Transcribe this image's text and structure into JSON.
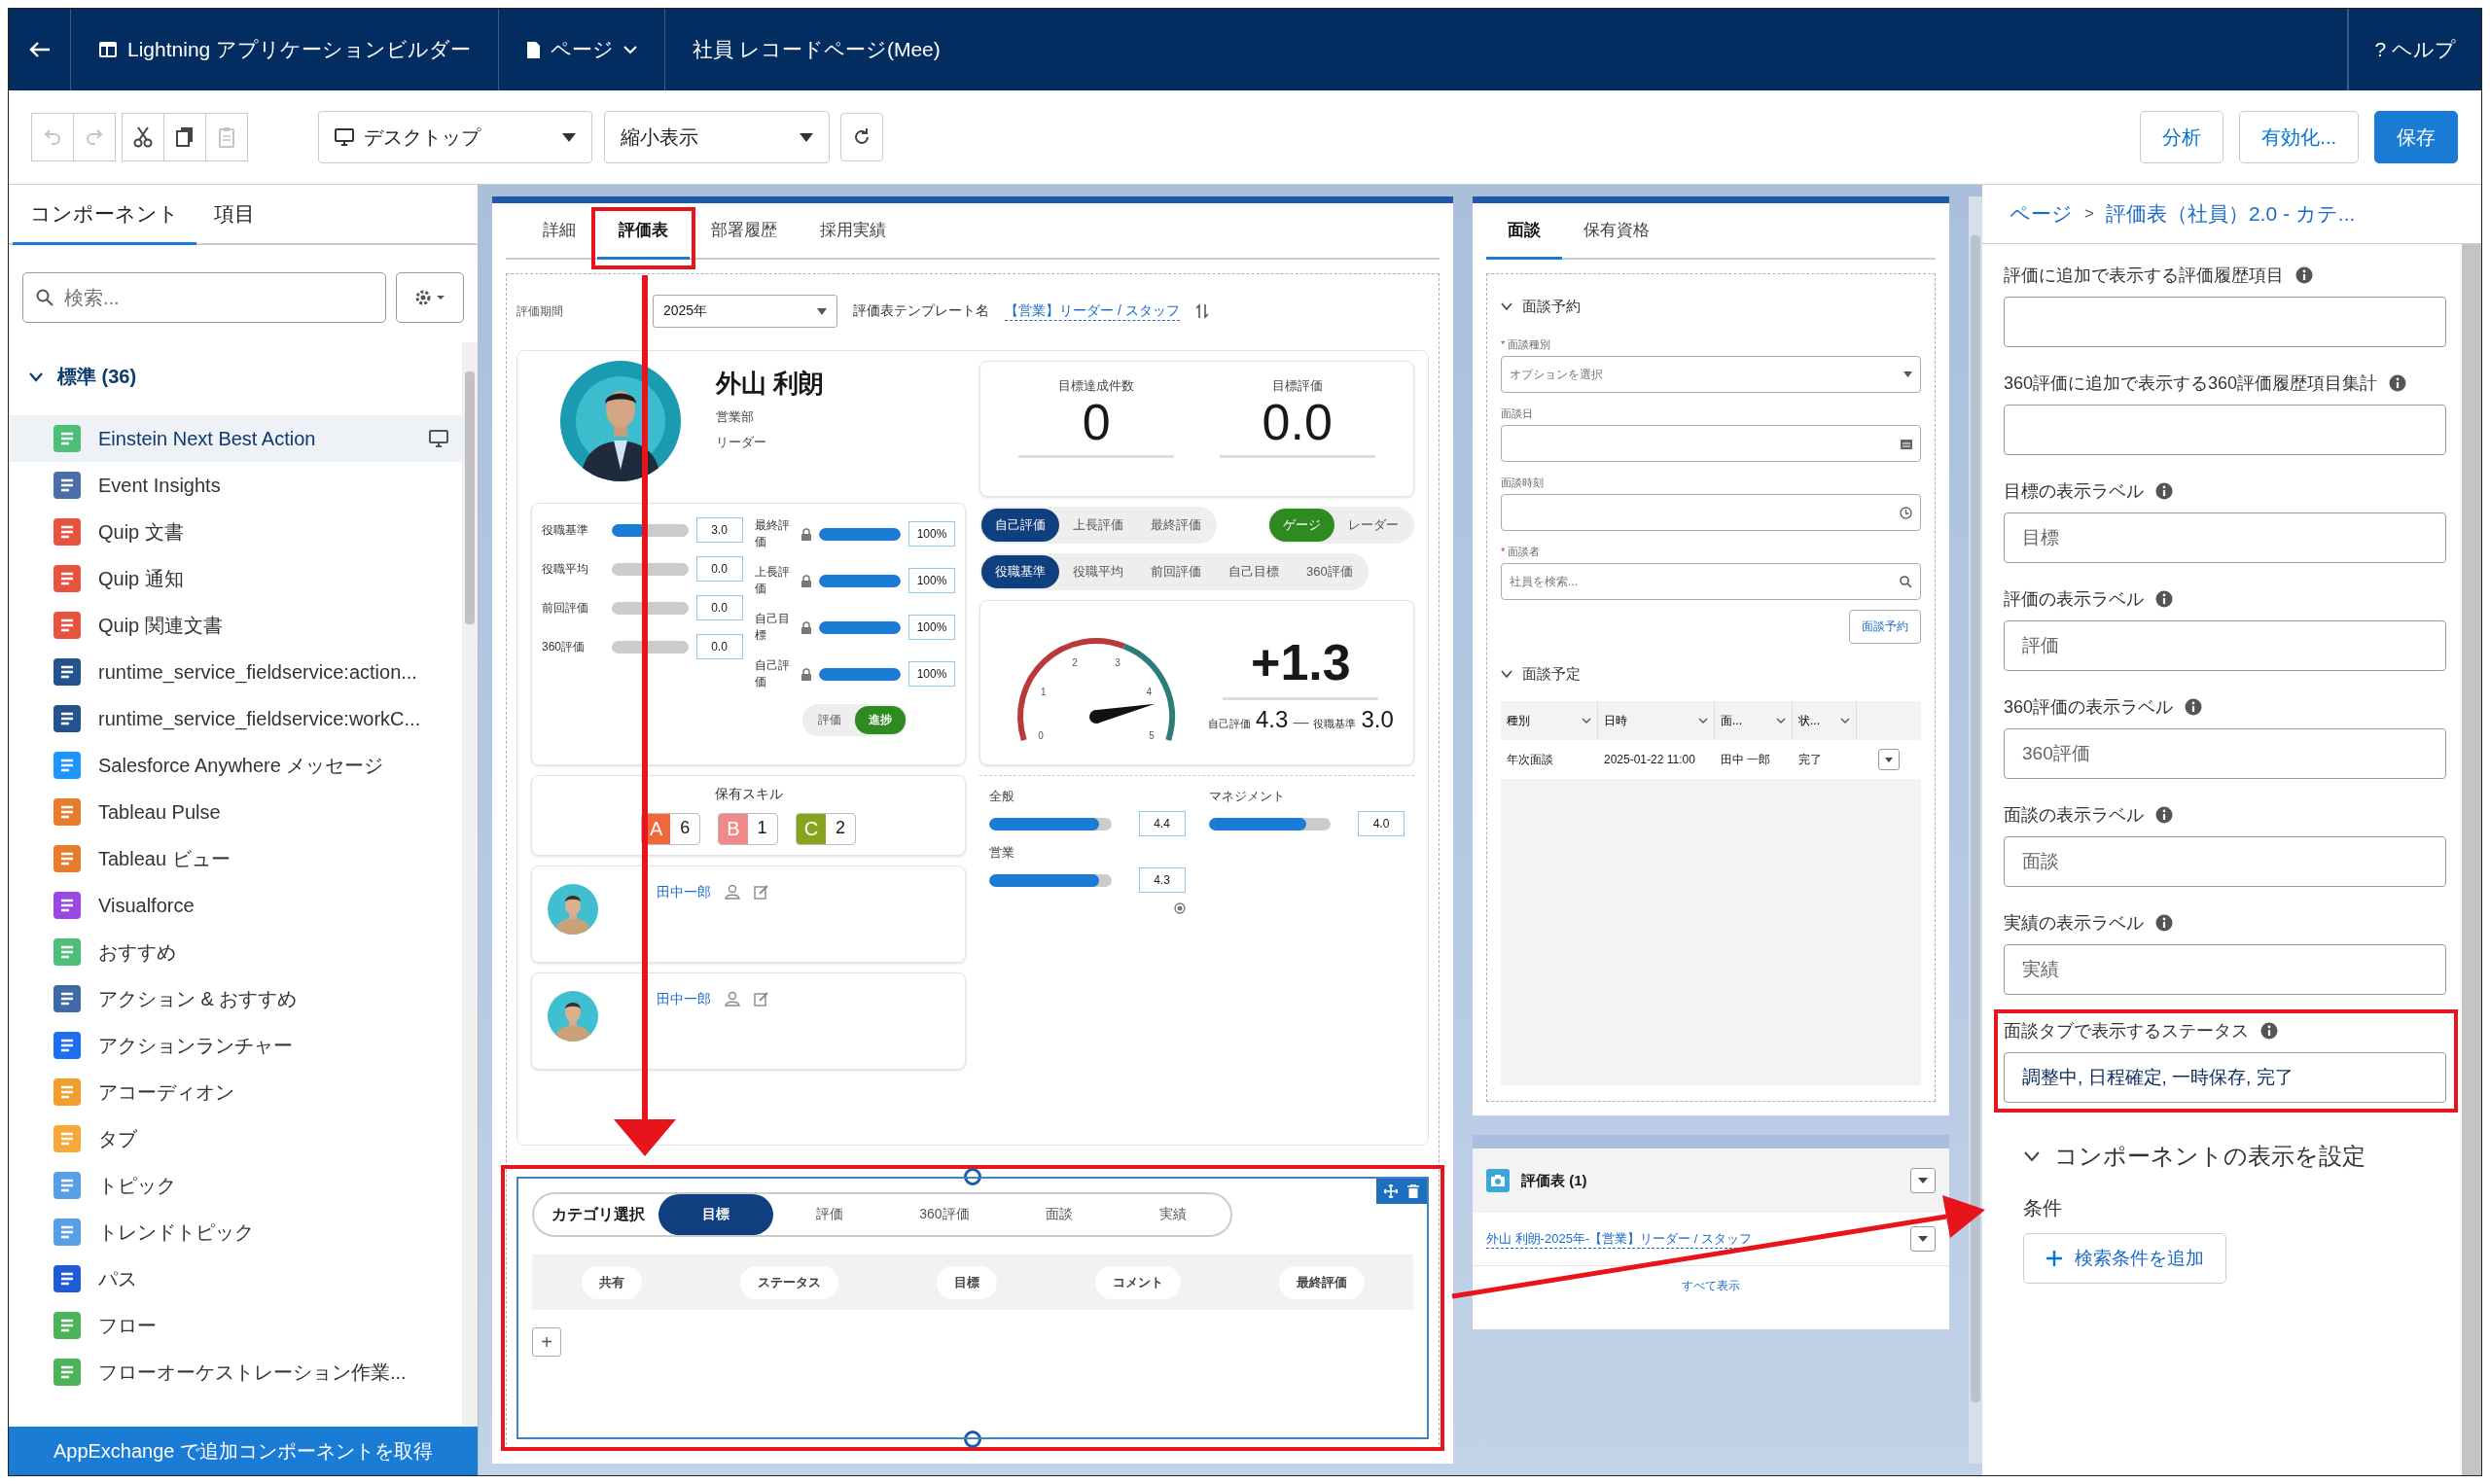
{
  "header": {
    "app_title": "Lightning アプリケーションビルダー",
    "page_menu": "ページ",
    "record_page": "社員 レコードページ(Mee)",
    "help_mark": "?",
    "help": "ヘルプ"
  },
  "toolbar": {
    "tools": [
      {
        "kind": "undo",
        "disabled": true
      },
      {
        "kind": "redo",
        "disabled": true
      },
      {
        "kind": "cut",
        "disabled": false
      },
      {
        "kind": "copy",
        "disabled": false
      },
      {
        "kind": "paste",
        "disabled": true
      }
    ],
    "device": "デスクトップ",
    "view": "縮小表示",
    "actions": [
      {
        "label": "分析",
        "primary": false
      },
      {
        "label": "有効化...",
        "primary": false
      },
      {
        "label": "保存",
        "primary": true
      }
    ]
  },
  "left_panel": {
    "tabs": [
      {
        "label": "コンポーネント",
        "selected": true
      },
      {
        "label": "項目",
        "selected": false
      }
    ],
    "search": {
      "placeholder": "検索..."
    },
    "group": {
      "title": "標準 (36)",
      "expanded": true,
      "items": [
        {
          "label": "Einstein Next Best Action",
          "color": "#4bc076",
          "selected": true
        },
        {
          "label": "Event Insights",
          "color": "#4a6ea8",
          "selected": false
        },
        {
          "label": "Quip 文書",
          "color": "#e8533f",
          "selected": false
        },
        {
          "label": "Quip 通知",
          "color": "#e8533f",
          "selected": false
        },
        {
          "label": "Quip 関連文書",
          "color": "#e8533f",
          "selected": false
        },
        {
          "label": "runtime_service_fieldservice:action...",
          "color": "#23538f",
          "selected": false
        },
        {
          "label": "runtime_service_fieldservice:workC...",
          "color": "#23538f",
          "selected": false
        },
        {
          "label": "Salesforce Anywhere メッセージ",
          "color": "#1b96ff",
          "selected": false
        },
        {
          "label": "Tableau Pulse",
          "color": "#e97b2c",
          "selected": false
        },
        {
          "label": "Tableau ビュー",
          "color": "#e97b2c",
          "selected": false
        },
        {
          "label": "Visualforce",
          "color": "#9b47e6",
          "selected": false
        },
        {
          "label": "おすすめ",
          "color": "#4bc076",
          "selected": false
        },
        {
          "label": "アクション & おすすめ",
          "color": "#3e6aa6",
          "selected": false
        },
        {
          "label": "アクションランチャー",
          "color": "#1b6ff0",
          "selected": false
        },
        {
          "label": "アコーディオン",
          "color": "#f39e2c",
          "selected": false
        },
        {
          "label": "タブ",
          "color": "#f8a739",
          "selected": false
        },
        {
          "label": "トピック",
          "color": "#56a0e8",
          "selected": false
        },
        {
          "label": "トレンドトピック",
          "color": "#56a0e8",
          "selected": false
        },
        {
          "label": "パス",
          "color": "#1e5bd6",
          "selected": false
        },
        {
          "label": "フロー",
          "color": "#4bb45a",
          "selected": false
        },
        {
          "label": "フローオーケストレーション作業...",
          "color": "#4bb45a",
          "selected": false
        }
      ]
    },
    "footer": "AppExchange で追加コンポーネントを取得"
  },
  "record_page": {
    "tabs": [
      {
        "label": "詳細",
        "selected": false
      },
      {
        "label": "評価表",
        "selected": true
      },
      {
        "label": "部署履歴",
        "selected": false
      },
      {
        "label": "採用実績",
        "selected": false
      }
    ],
    "period": {
      "label": "評価期間",
      "value": "2025年"
    },
    "template": {
      "label": "評価表テンプレート名",
      "value": "【営業】リーダー / スタッフ"
    },
    "profile": {
      "name": "外山 利朗",
      "department": "営業部",
      "role": "リーダー"
    },
    "scores": [
      {
        "label": "役職基準",
        "level": 0.45,
        "value": "3.0"
      },
      {
        "label": "役職平均",
        "level": 0,
        "value": "0.0"
      },
      {
        "label": "前回評価",
        "level": 0,
        "value": "0.0"
      },
      {
        "label": "360評価",
        "level": 0,
        "value": "0.0"
      }
    ],
    "weights": [
      {
        "label": "最終評価",
        "locked": true,
        "level": 1,
        "value": "100%"
      },
      {
        "label": "上長評価",
        "locked": true,
        "level": 1,
        "value": "100%"
      },
      {
        "label": "自己目標",
        "locked": true,
        "level": 1,
        "value": "100%"
      },
      {
        "label": "自己評価",
        "locked": true,
        "level": 1,
        "value": "100%"
      }
    ],
    "mode": [
      {
        "label": "評価",
        "selected": false
      },
      {
        "label": "進捗",
        "selected": true
      }
    ],
    "kpis": [
      {
        "label": "目標達成件数",
        "value": "0"
      },
      {
        "label": "目標評価",
        "value": "0.0"
      }
    ],
    "source_pills": [
      {
        "label": "自己評価",
        "selected": true
      },
      {
        "label": "上長評価",
        "selected": false
      },
      {
        "label": "最終評価",
        "selected": false
      }
    ],
    "chart_pills": [
      {
        "label": "ゲージ",
        "selected": true
      },
      {
        "label": "レーダー",
        "selected": false
      }
    ],
    "base_pills": [
      {
        "label": "役職基準",
        "selected": true
      },
      {
        "label": "役職平均",
        "selected": false
      },
      {
        "label": "前回評価",
        "selected": false
      },
      {
        "label": "自己目標",
        "selected": false
      },
      {
        "label": "360評価",
        "selected": false
      }
    ],
    "gauge": {
      "ticks": [
        "0",
        "1",
        "2",
        "3",
        "4",
        "5"
      ],
      "level": 0.86,
      "delta": "+1.3",
      "self_label": "自己評価",
      "self_value": "4.3",
      "separator": "—",
      "base_label": "役職基準",
      "base_value": "3.0"
    },
    "skills": {
      "title": "保有スキル",
      "items": [
        {
          "grade": "A",
          "count": "6",
          "color": "#f0683a"
        },
        {
          "grade": "B",
          "count": "1",
          "color": "#f08a8a"
        },
        {
          "grade": "C",
          "count": "2",
          "color": "#86a51c"
        }
      ]
    },
    "categories": [
      {
        "label": "全般",
        "level": 0.9,
        "value": "4.4"
      },
      {
        "label": "マネジメント",
        "level": 0.8,
        "value": "4.0"
      },
      {
        "label": "営業",
        "level": 0.9,
        "value": "4.3"
      }
    ],
    "people": [
      {
        "name": "田中一郎"
      },
      {
        "name": "田中一郎"
      }
    ],
    "category_component": {
      "title": "カテゴリ選択",
      "tabs": [
        {
          "label": "目標",
          "selected": true
        },
        {
          "label": "評価",
          "selected": false
        },
        {
          "label": "360評価",
          "selected": false
        },
        {
          "label": "面談",
          "selected": false
        },
        {
          "label": "実績",
          "selected": false
        }
      ],
      "columns": [
        "共有",
        "ステータス",
        "目標",
        "コメント",
        "最終評価"
      ],
      "add": "+"
    }
  },
  "side_card": {
    "tabs": [
      {
        "label": "面談",
        "selected": true
      },
      {
        "label": "保有資格",
        "selected": false
      }
    ],
    "booking": {
      "title": "面談予約",
      "expanded": true,
      "required_mark": "*",
      "fields": [
        {
          "label": "面談種別",
          "required": true,
          "kind": "select",
          "placeholder": "オプションを選択"
        },
        {
          "label": "面談日",
          "required": false,
          "kind": "date"
        },
        {
          "label": "面談時刻",
          "required": false,
          "kind": "time"
        },
        {
          "label": "面談者",
          "required": true,
          "kind": "search",
          "placeholder": "社員を検索..."
        }
      ],
      "button": "面談予約"
    },
    "schedule": {
      "title": "面談予定",
      "expanded": true,
      "columns": [
        "種別",
        "日時",
        "面...",
        "状..."
      ],
      "rows": [
        [
          "年次面談",
          "2025-01-22 11:00",
          "田中 一郎",
          "完了"
        ]
      ]
    },
    "related": {
      "title": "評価表 (1)",
      "record": "外山 利朗-2025年-【営業】リーダー / スタッフ",
      "view_all": "すべて表示"
    }
  },
  "properties": {
    "breadcrumb": [
      "ページ",
      "評価表（社員）2.0 - カテ..."
    ],
    "breadcrumb_separator": ">",
    "fields": [
      {
        "label": "評価に追加で表示する評価履歴項目"
      },
      {
        "label": "360評価に追加で表示する360評価履歴項目集計"
      },
      {
        "label": "目標の表示ラベル",
        "placeholder": "目標"
      },
      {
        "label": "評価の表示ラベル",
        "placeholder": "評価"
      },
      {
        "label": "360評価の表示ラベル",
        "placeholder": "360評価"
      },
      {
        "label": "面談の表示ラベル",
        "placeholder": "面談"
      },
      {
        "label": "実績の表示ラベル",
        "placeholder": "実績"
      },
      {
        "label": "面談タブで表示するステータス",
        "value": "調整中, 日程確定, 一時保存, 完了",
        "highlighted": true
      }
    ],
    "visibility": {
      "title": "コンポーネントの表示を設定",
      "expanded": true,
      "condition_label": "条件",
      "add_button": "検索条件を追加"
    }
  }
}
